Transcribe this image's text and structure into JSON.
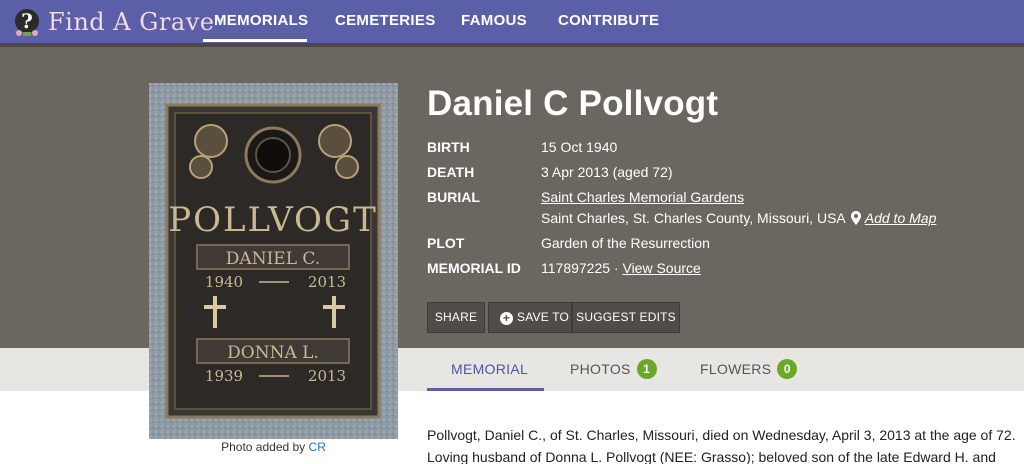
{
  "brand": {
    "name": "Find A Grave",
    "tm": "™"
  },
  "nav": {
    "items": [
      {
        "label": "MEMORIALS",
        "active": true
      },
      {
        "label": "CEMETERIES"
      },
      {
        "label": "FAMOUS"
      },
      {
        "label": "CONTRIBUTE"
      }
    ]
  },
  "photo": {
    "stone_surname": "POLLVOGT",
    "stone_name_1": "DANIEL C.",
    "stone_birth_1": "1940",
    "stone_death_1": "2013",
    "stone_name_2": "DONNA L.",
    "stone_birth_2": "1939",
    "stone_death_2": "2013",
    "caption_prefix": "Photo added by",
    "caption_author": "CR"
  },
  "memorial": {
    "name": "Daniel C Pollvogt",
    "birth_label": "BIRTH",
    "birth_value": "15 Oct 1940",
    "death_label": "DEATH",
    "death_value": "3 Apr 2013 (aged 72)",
    "burial_label": "BURIAL",
    "burial_cemetery": "Saint Charles Memorial Gardens",
    "burial_location": "Saint Charles, St. Charles County, Missouri, USA",
    "add_to_map": "Add to Map",
    "plot_label": "PLOT",
    "plot_value": "Garden of the Resurrection",
    "memorial_id_label": "MEMORIAL ID",
    "memorial_id_value": "117897225 ·",
    "view_source": "View Source"
  },
  "actions": {
    "share": "SHARE",
    "save_to": "SAVE TO",
    "suggest_edits": "SUGGEST EDITS"
  },
  "tabs": {
    "memorial": "MEMORIAL",
    "photos": "PHOTOS",
    "photos_count": "1",
    "flowers": "FLOWERS",
    "flowers_count": "0"
  },
  "bio": {
    "line1": "Pollvogt, Daniel C., of St. Charles, Missouri, died on Wednesday, April 3, 2013 at the age of 72.",
    "line2": "Loving husband of Donna L. Pollvogt (NEE: Grasso); beloved son of the late Edward H. and"
  },
  "colors": {
    "nav_bg": "#5b5fa8",
    "hero_bg": "#6b6660",
    "tab_band_bg": "#e8e6e2",
    "badge_green": "#6ba82a",
    "link_blue": "#2a6ebb"
  }
}
